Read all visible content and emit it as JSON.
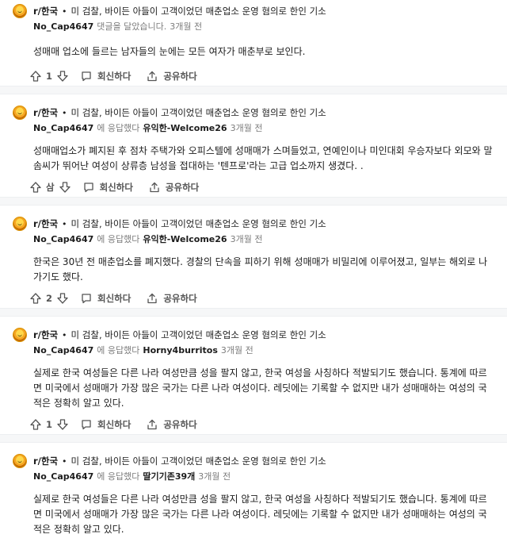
{
  "actions": {
    "reply_label": "회신하다",
    "share_label": "공유하다"
  },
  "comments": [
    {
      "subreddit": "r/한국",
      "post_title": "미 검찰, 바이든 아들이 고객이었던 매춘업소 운영 혐의로 한인 기소",
      "user": "No_Cap4647",
      "action_text": "댓글을 달았습니다.",
      "parent_user": "",
      "time": "3개월 전",
      "body": "성매매 업소에 들르는 남자들의 눈에는 모든 여자가 매춘부로 보인다.",
      "votes": "1"
    },
    {
      "subreddit": "r/한국",
      "post_title": "미 검찰, 바이든 아들이 고객이었던 매춘업소 운영 혐의로 한인 기소",
      "user": "No_Cap4647",
      "action_text": "에 응답했다",
      "parent_user": "유익한-Welcome26",
      "time": "3개월 전",
      "body": "성매매업소가 폐지된 후 점차 주택가와 오피스텔에 성매매가 스며들었고, 연예인이나 미인대회 우승자보다 외모와 말솜씨가 뛰어난 여성이 상류층 남성을 접대하는 '텐프로'라는 고급 업소까지 생겼다. .",
      "votes": "삼"
    },
    {
      "subreddit": "r/한국",
      "post_title": "미 검찰, 바이든 아들이 고객이었던 매춘업소 운영 혐의로 한인 기소",
      "user": "No_Cap4647",
      "action_text": "에 응답했다",
      "parent_user": "유익한-Welcome26",
      "time": "3개월 전",
      "body": "한국은 30년 전 매춘업소를 폐지했다. 경찰의 단속을 피하기 위해 성매매가 비밀리에 이루어졌고, 일부는 해외로 나가기도 했다.",
      "votes": "2"
    },
    {
      "subreddit": "r/한국",
      "post_title": "미 검찰, 바이든 아들이 고객이었던 매춘업소 운영 혐의로 한인 기소",
      "user": "No_Cap4647",
      "action_text": "에 응답했다",
      "parent_user": "Horny4burritos",
      "time": "3개월 전",
      "body": "실제로 한국 여성들은 다른 나라 여성만큼 성을 팔지 않고, 한국 여성을 사칭하다 적발되기도 했습니다. 통계에 따르면 미국에서 성매매가 가장 많은 국가는 다른 나라 여성이다. 레딧에는 기록할 수 없지만 내가 성매매하는 여성의 국적은 정확히 알고 있다.",
      "votes": "1"
    },
    {
      "subreddit": "r/한국",
      "post_title": "미 검찰, 바이든 아들이 고객이었던 매춘업소 운영 혐의로 한인 기소",
      "user": "No_Cap4647",
      "action_text": "에 응답했다",
      "parent_user": "딸기기존39개",
      "time": "3개월 전",
      "body": "실제로 한국 여성들은 다른 나라 여성만큼 성을 팔지 않고, 한국 여성을 사칭하다 적발되기도 했습니다. 통계에 따르면 미국에서 성매매가 가장 많은 국가는 다른 나라 여성이다. 레딧에는 기록할 수 없지만 내가 성매매하는 여성의 국적은 정확히 알고 있다.",
      "votes": ""
    }
  ]
}
